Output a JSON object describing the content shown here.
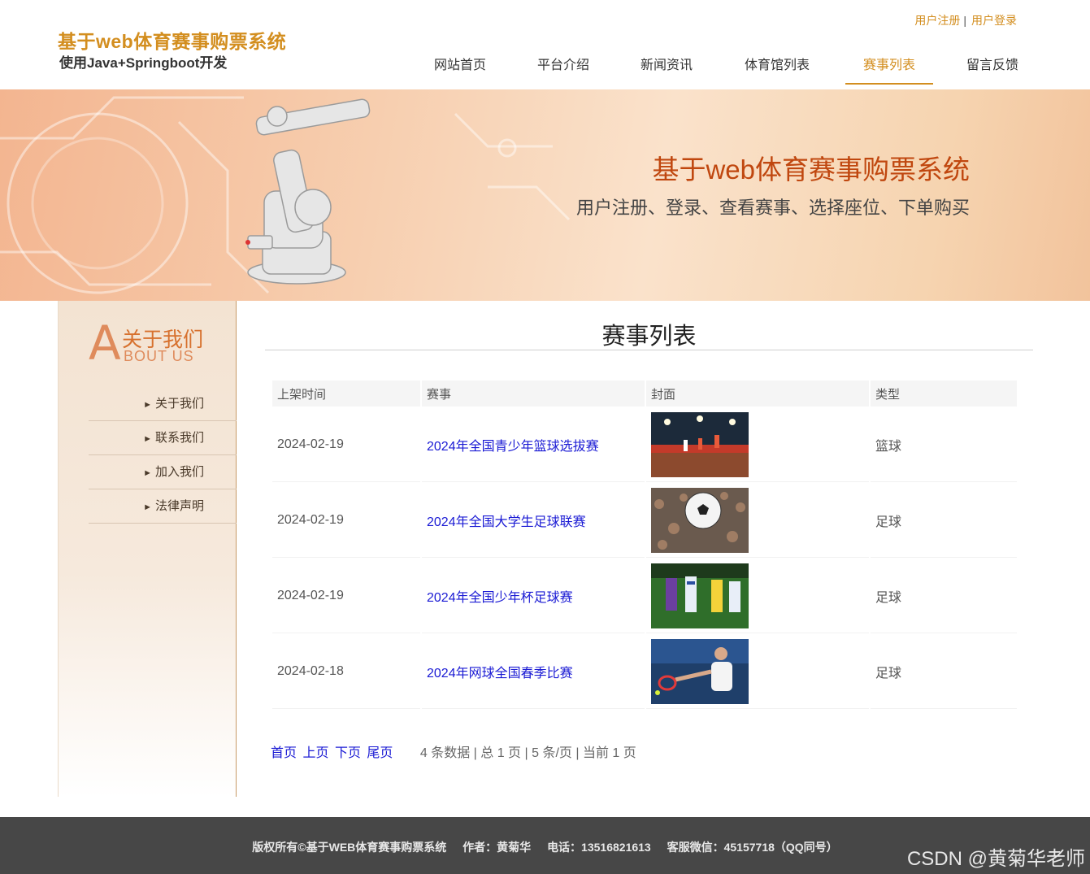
{
  "header": {
    "logo_title": "基于web体育赛事购票系统",
    "logo_sub": "使用Java+Springboot开发",
    "register_link": "用户注册",
    "separator": "|",
    "login_link": "用户登录",
    "nav": [
      {
        "label": "网站首页"
      },
      {
        "label": "平台介绍"
      },
      {
        "label": "新闻资讯"
      },
      {
        "label": "体育馆列表"
      },
      {
        "label": "赛事列表"
      },
      {
        "label": "留言反馈"
      }
    ],
    "active_nav": "赛事列表"
  },
  "banner": {
    "title": "基于web体育赛事购票系统",
    "subtitle": "用户注册、登录、查看赛事、选择座位、下单购买"
  },
  "sidebar": {
    "about_letter": "A",
    "about_cn": "关于我们",
    "about_en": "BOUT US",
    "items": [
      {
        "label": "关于我们"
      },
      {
        "label": "联系我们"
      },
      {
        "label": "加入我们"
      },
      {
        "label": "法律声明"
      }
    ]
  },
  "main": {
    "title": "赛事列表",
    "columns": [
      "上架时间",
      "赛事",
      "封面",
      "类型"
    ],
    "rows": [
      {
        "date": "2024-02-19",
        "event": "2024年全国青少年篮球选拔赛",
        "cover": "basketball-arena-photo",
        "type": "篮球"
      },
      {
        "date": "2024-02-19",
        "event": "2024年全国大学生足球联赛",
        "cover": "soccer-ball-crowd-photo",
        "type": "足球"
      },
      {
        "date": "2024-02-19",
        "event": "2024年全国少年杯足球赛",
        "cover": "soccer-players-photo",
        "type": "足球"
      },
      {
        "date": "2024-02-18",
        "event": "2024年网球全国春季比赛",
        "cover": "tennis-player-photo",
        "type": "足球"
      }
    ]
  },
  "pager": {
    "first": "首页",
    "prev": "上页",
    "next": "下页",
    "last": "尾页",
    "info": "4 条数据 | 总 1 页 | 5 条/页 | 当前 1 页"
  },
  "footer": {
    "copyright": "版权所有©基于WEB体育赛事购票系统",
    "author": "作者：黄菊华",
    "phone": "电话：13516821613",
    "wechat": "客服微信：45157718（QQ同号）"
  },
  "watermark": "CSDN @黄菊华老师",
  "colors": {
    "accent": "#d38e1f",
    "link": "#1a1ad4",
    "banner_title": "#c0470f",
    "footer_bg": "#474747"
  }
}
